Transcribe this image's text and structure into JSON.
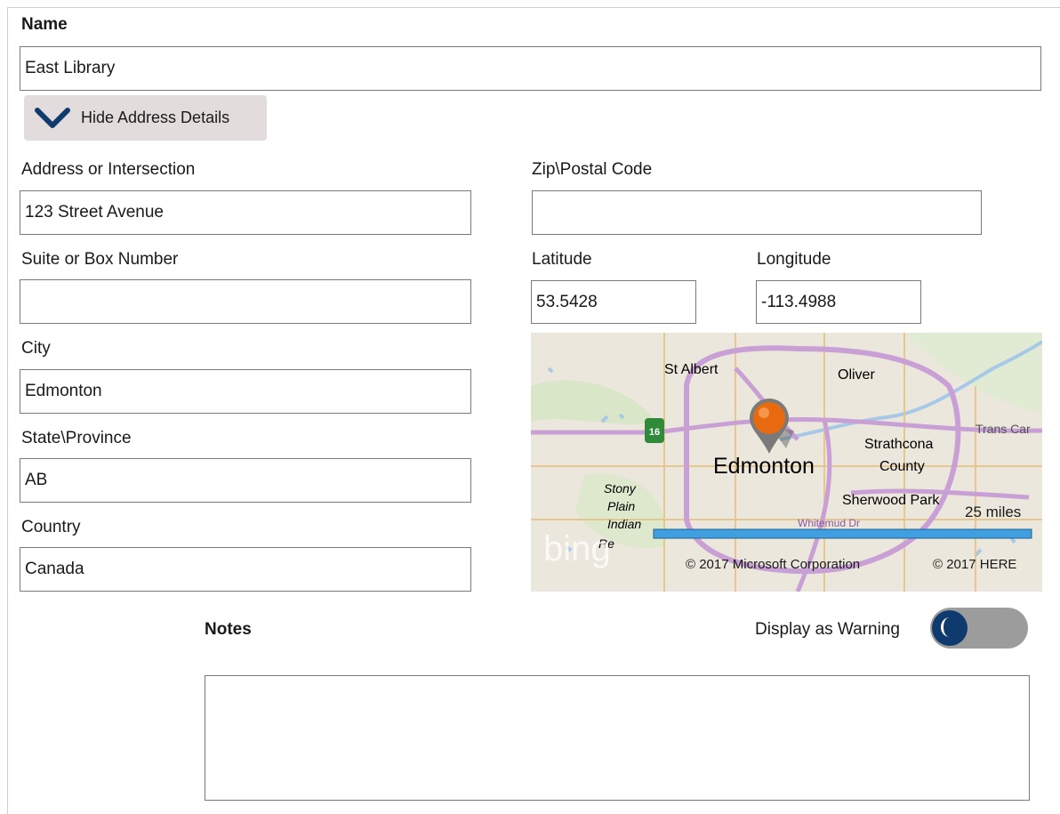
{
  "form": {
    "name_label": "Name",
    "name_value": "East Library",
    "toggle_label": "Hide Address Details",
    "address_label": "Address or Intersection",
    "address_value": "123 Street Avenue",
    "suite_label": "Suite or Box Number",
    "suite_value": "",
    "city_label": "City",
    "city_value": "Edmonton",
    "state_label": "State\\Province",
    "state_value": "AB",
    "country_label": "Country",
    "country_value": "Canada",
    "zip_label": "Zip\\Postal Code",
    "zip_value": "",
    "latitude_label": "Latitude",
    "latitude_value": "53.5428",
    "longitude_label": "Longitude",
    "longitude_value": "-113.4988",
    "notes_label": "Notes",
    "notes_value": "",
    "warning_label": "Display as Warning",
    "warning_on": false
  },
  "map": {
    "city_main": "Edmonton",
    "places": [
      "St Albert",
      "Oliver",
      "Strathcona",
      "County",
      "Sherwood Park",
      "Trans Car",
      "Stony",
      "Plain",
      "Indian",
      "Re"
    ],
    "road_label": "Whitemud Dr",
    "highway_number": "16",
    "scale_label": "25 miles",
    "copyright_ms": "© 2017 Microsoft Corporation",
    "copyright_here": "© 2017 HERE",
    "logo_text": "bing",
    "marker_color": "#e86a10"
  },
  "colors": {
    "accent_dark": "#0f3a6e",
    "toggle_bg": "#e2dcdc",
    "border": "#7a7a7a"
  },
  "icons": {
    "toggle": "chevron-down-icon",
    "marker": "map-pin-icon",
    "highway": "highway-shield-icon"
  }
}
